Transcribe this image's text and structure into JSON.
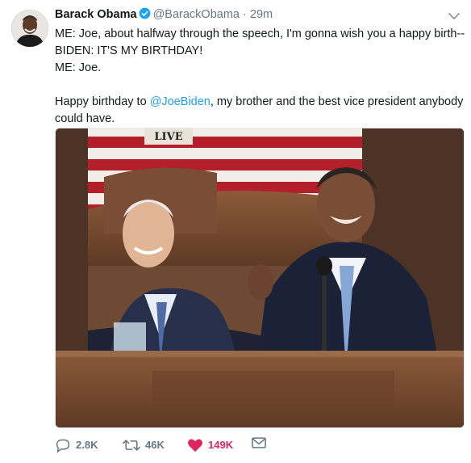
{
  "tweet": {
    "name": "Barack Obama",
    "handle": "@BarackObama",
    "separator": "·",
    "time": "29m",
    "lines": [
      "ME:  Joe, about halfway through the speech, I'm gonna wish you a happy birth--",
      "BIDEN:  IT'S MY BIRTHDAY!",
      "ME:  Joe."
    ],
    "body_prefix": "Happy birthday to ",
    "mention": "@JoeBiden",
    "body_suffix": ", my brother and the best vice president anybody could have.",
    "media_label": "LIVE"
  },
  "actions": {
    "replies": "2.8K",
    "retweets": "46K",
    "likes": "149K"
  },
  "icons": {
    "verified": "verified-badge-icon",
    "caret": "chevron-down-icon",
    "reply": "reply-icon",
    "retweet": "retweet-icon",
    "like": "heart-icon",
    "dm": "envelope-icon"
  },
  "colors": {
    "link": "#1da1f2",
    "like": "#e0245e",
    "muted": "#657786"
  }
}
